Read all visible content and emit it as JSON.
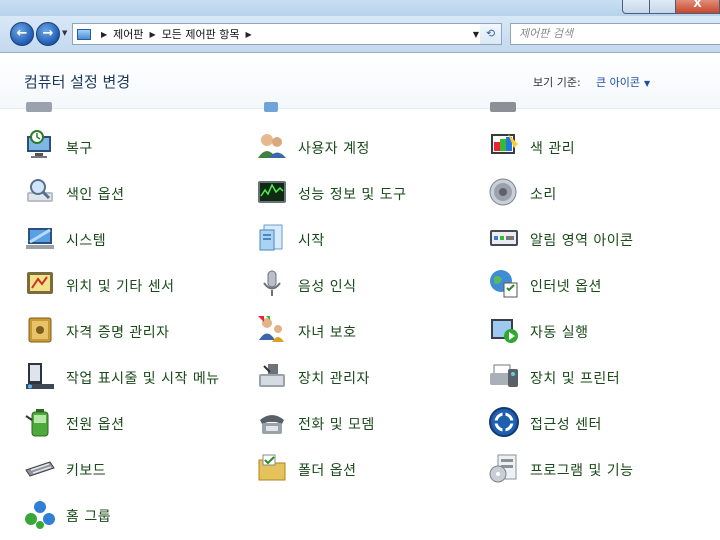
{
  "window": {
    "close_glyph": "X"
  },
  "toolbar": {
    "back_glyph": "←",
    "forward_glyph": "→",
    "breadcrumb": [
      "제어판",
      "모든 제어판 항목"
    ],
    "search_placeholder": "제어판 검색"
  },
  "header": {
    "title": "컴퓨터 설정 변경",
    "view_by_label": "보기 기준:",
    "view_by_value": "큰 아이콘"
  },
  "items": [
    {
      "label": "복구",
      "icon": "recovery-icon"
    },
    {
      "label": "사용자 계정",
      "icon": "user-accounts-icon"
    },
    {
      "label": "색 관리",
      "icon": "color-management-icon"
    },
    {
      "label": "색인 옵션",
      "icon": "indexing-options-icon"
    },
    {
      "label": "성능 정보 및 도구",
      "icon": "performance-icon"
    },
    {
      "label": "소리",
      "icon": "sound-icon"
    },
    {
      "label": "시스템",
      "icon": "system-icon"
    },
    {
      "label": "시작",
      "icon": "getting-started-icon"
    },
    {
      "label": "알림 영역 아이콘",
      "icon": "notification-area-icon"
    },
    {
      "label": "위치 및 기타 센서",
      "icon": "location-sensors-icon"
    },
    {
      "label": "음성 인식",
      "icon": "speech-recognition-icon"
    },
    {
      "label": "인터넷 옵션",
      "icon": "internet-options-icon"
    },
    {
      "label": "자격 증명 관리자",
      "icon": "credential-manager-icon"
    },
    {
      "label": "자녀 보호",
      "icon": "parental-controls-icon"
    },
    {
      "label": "자동 실행",
      "icon": "autoplay-icon"
    },
    {
      "label": "작업 표시줄 및 시작 메뉴",
      "icon": "taskbar-start-menu-icon"
    },
    {
      "label": "장치 관리자",
      "icon": "device-manager-icon"
    },
    {
      "label": "장치 및 프린터",
      "icon": "devices-printers-icon"
    },
    {
      "label": "전원 옵션",
      "icon": "power-options-icon"
    },
    {
      "label": "전화 및 모뎀",
      "icon": "phone-modem-icon"
    },
    {
      "label": "접근성 센터",
      "icon": "ease-of-access-icon"
    },
    {
      "label": "키보드",
      "icon": "keyboard-icon"
    },
    {
      "label": "폴더 옵션",
      "icon": "folder-options-icon"
    },
    {
      "label": "프로그램 및 기능",
      "icon": "programs-features-icon"
    },
    {
      "label": "홈 그룹",
      "icon": "homegroup-icon"
    }
  ]
}
